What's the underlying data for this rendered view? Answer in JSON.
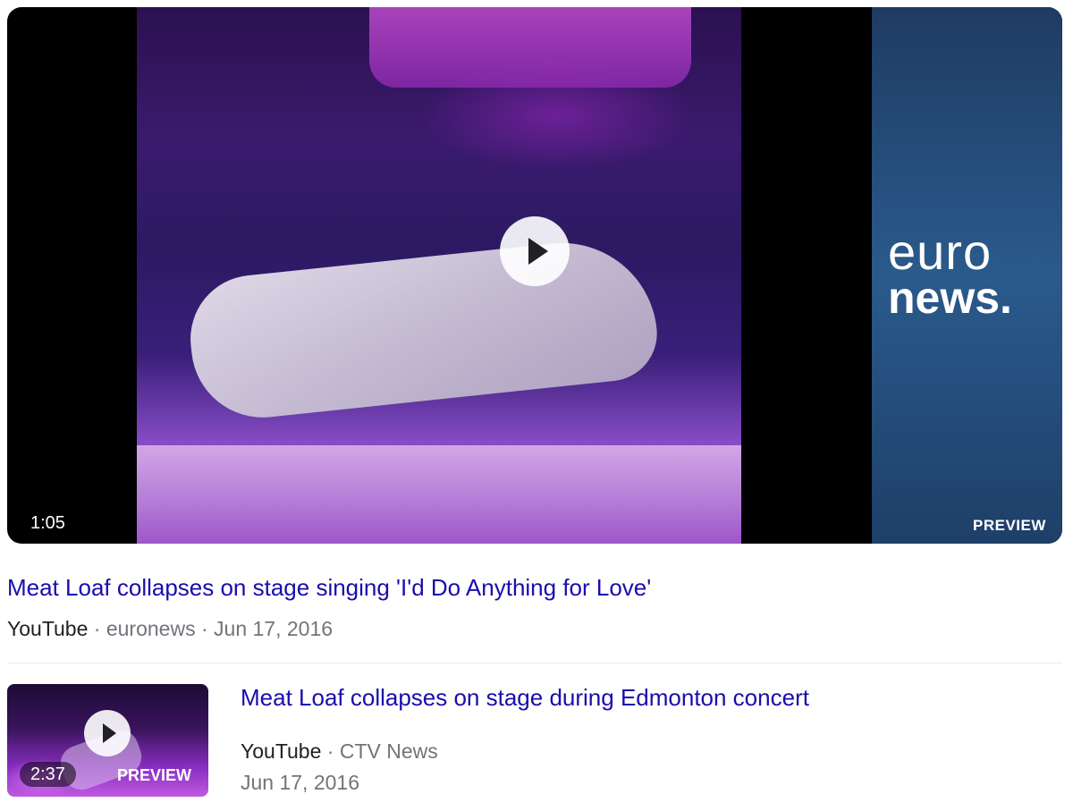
{
  "results": [
    {
      "title": "Meat Loaf collapses on stage singing 'I'd Do Anything for Love'",
      "source": "YouTube",
      "separator": "·",
      "channel": "euronews",
      "date": "Jun 17, 2016",
      "duration": "1:05",
      "preview_label": "PREVIEW",
      "logo_text": [
        "euro",
        "news."
      ]
    },
    {
      "title": "Meat Loaf collapses on stage during Edmonton concert",
      "source": "YouTube",
      "separator": "·",
      "channel": "CTV News",
      "date": "Jun 17, 2016",
      "duration": "2:37",
      "preview_label": "PREVIEW"
    }
  ],
  "icons": {
    "play": "play-icon"
  },
  "colors": {
    "link": "#1a0dab",
    "meta": "#70757a",
    "source": "#202124"
  }
}
